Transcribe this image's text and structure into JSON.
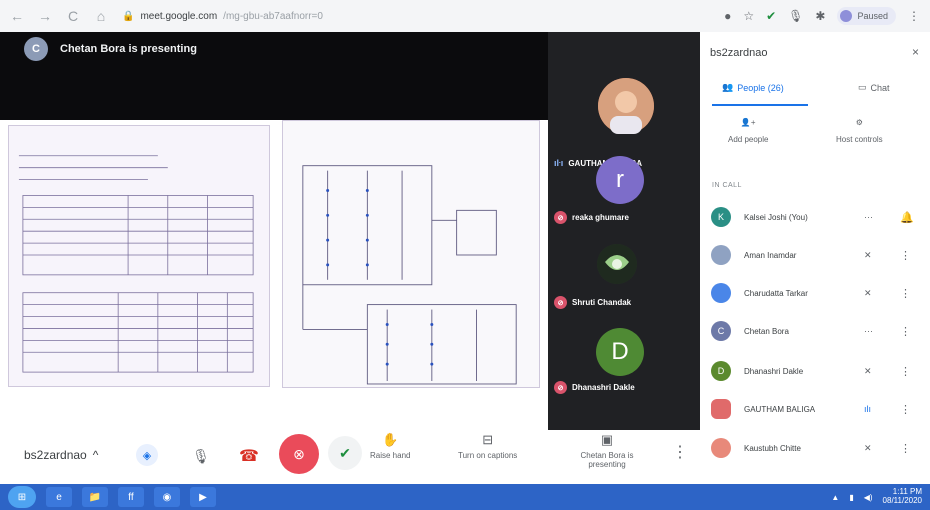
{
  "browser": {
    "back": "←",
    "forward": "→",
    "reload": "C",
    "home": "⌂",
    "url_host": "meet.google.com",
    "url_path": "/mg-gbu-ab7aafnorr=0",
    "paused_label": "Paused"
  },
  "stage": {
    "presenter_initial": "C",
    "presenter_text": "Chetan Bora is presenting"
  },
  "tiles": [
    {
      "name": "GAUTHAM BALIGA",
      "initial": "",
      "color": "#c45a3a",
      "status": "speaking"
    },
    {
      "name": "reaka ghumare",
      "initial": "r",
      "color": "#7d6dc9",
      "status": "muted"
    },
    {
      "name": "Shruti Chandak",
      "initial": "",
      "color": "#3a4a3a",
      "status": "muted"
    },
    {
      "name": "Dhanashri Dakle",
      "initial": "D",
      "color": "#4f8a34",
      "status": "muted"
    }
  ],
  "controls": {
    "meeting_code": "bs2zardnao",
    "chevron": "^",
    "raise_hand": "Raise hand",
    "captions": "Turn on captions",
    "presenting": "Chetan Bora is presenting",
    "more": "⋮"
  },
  "panel": {
    "title": "bs2zardnao",
    "close": "×",
    "people_tab": "People (26)",
    "chat_tab": "Chat",
    "add_people": "Add people",
    "host_controls": "Host controls",
    "in_call": "IN CALL",
    "participants": [
      {
        "initial": "K",
        "name": "Kalsei Joshi (You)",
        "color": "#2a8f85",
        "status": "···",
        "more": "🔔"
      },
      {
        "initial": "",
        "name": "Aman Inamdar",
        "color": "#8fa2c2",
        "status": "✕",
        "more": "⋮"
      },
      {
        "initial": "",
        "name": "Charudatta Tarkar",
        "color": "#4a86e8",
        "status": "✕",
        "more": "⋮"
      },
      {
        "initial": "C",
        "name": "Chetan Bora",
        "color": "#6d79a8",
        "status": "···",
        "more": "⋮"
      },
      {
        "initial": "D",
        "name": "Dhanashri Dakle",
        "color": "#5b8a2e",
        "status": "✕",
        "more": "⋮"
      },
      {
        "initial": "",
        "name": "GAUTHAM BALIGA",
        "color": "#e06a6a",
        "status": "ılı",
        "more": "⋮"
      },
      {
        "initial": "",
        "name": "Kaustubh Chitte",
        "color": "#e8897a",
        "status": "✕",
        "more": "⋮"
      }
    ]
  },
  "taskbar": {
    "start": "⊞",
    "apps": [
      "e",
      "📁",
      "ff",
      "◉",
      "▶"
    ],
    "time": "1:11 PM",
    "date": "08/11/2020"
  }
}
